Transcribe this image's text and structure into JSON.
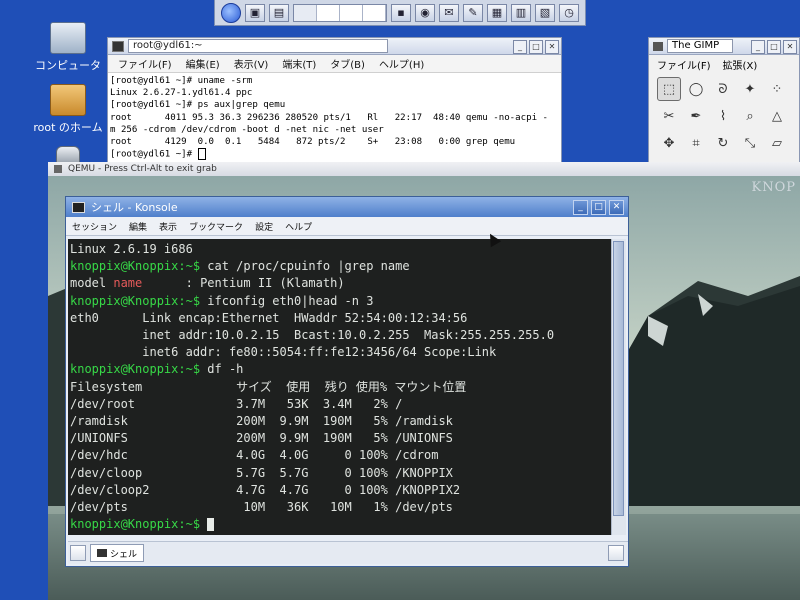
{
  "desktop": {
    "icons": [
      {
        "label": "コンピュータ"
      },
      {
        "label": "root のホーム"
      },
      {
        "label": ""
      }
    ]
  },
  "gnome_terminal": {
    "title": "root@ydl61:~",
    "menu": [
      "ファイル(F)",
      "編集(E)",
      "表示(V)",
      "端末(T)",
      "タブ(B)",
      "ヘルプ(H)"
    ],
    "lines": [
      "[root@ydl61 ~]# uname -srm",
      "Linux 2.6.27-1.ydl61.4 ppc",
      "[root@ydl61 ~]# ps aux|grep qemu",
      "root      4011 95.3 36.3 296236 280520 pts/1   Rl   22:17  48:40 qemu -no-acpi -",
      "m 256 -cdrom /dev/cdrom -boot d -net nic -net user",
      "root      4129  0.0  0.1   5484   872 pts/2    S+   23:08   0:00 grep qemu",
      "[root@ydl61 ~]# "
    ]
  },
  "gimp": {
    "title": "The GIMP",
    "menu": [
      "ファイル(F)",
      "拡張(X)"
    ]
  },
  "qemu": {
    "title": "QEMU - Press Ctrl-Alt to exit grab",
    "watermark": "KNOP"
  },
  "konsole": {
    "title": "シェル - Konsole",
    "menu": [
      "セッション",
      "編集",
      "表示",
      "ブックマーク",
      "設定",
      "ヘルプ"
    ],
    "tab_label": "シェル",
    "prompt": "knoppix@Knoppix:~$",
    "lines": {
      "l1": "Linux 2.6.19 i686",
      "cmd1": " cat /proc/cpuinfo |grep name",
      "l2a": "model ",
      "l2b": "name",
      "l2c": "      : Pentium II (Klamath)",
      "cmd2": " ifconfig eth0|head -n 3",
      "l3": "eth0      Link encap:Ethernet  HWaddr 52:54:00:12:34:56",
      "l4": "          inet addr:10.0.2.15  Bcast:10.0.2.255  Mask:255.255.255.0",
      "l5": "          inet6 addr: fe80::5054:ff:fe12:3456/64 Scope:Link",
      "cmd3": " df -h",
      "hdr": "Filesystem             サイズ  使用  残り 使用% マウント位置",
      "rows": [
        "/dev/root              3.7M   53K  3.4M   2% /",
        "/ramdisk               200M  9.9M  190M   5% /ramdisk",
        "/UNIONFS               200M  9.9M  190M   5% /UNIONFS",
        "/dev/hdc               4.0G  4.0G     0 100% /cdrom",
        "/dev/cloop             5.7G  5.7G     0 100% /KNOPPIX",
        "/dev/cloop2            4.7G  4.7G     0 100% /KNOPPIX2",
        "/dev/pts                10M   36K   10M   1% /dev/pts"
      ]
    }
  }
}
